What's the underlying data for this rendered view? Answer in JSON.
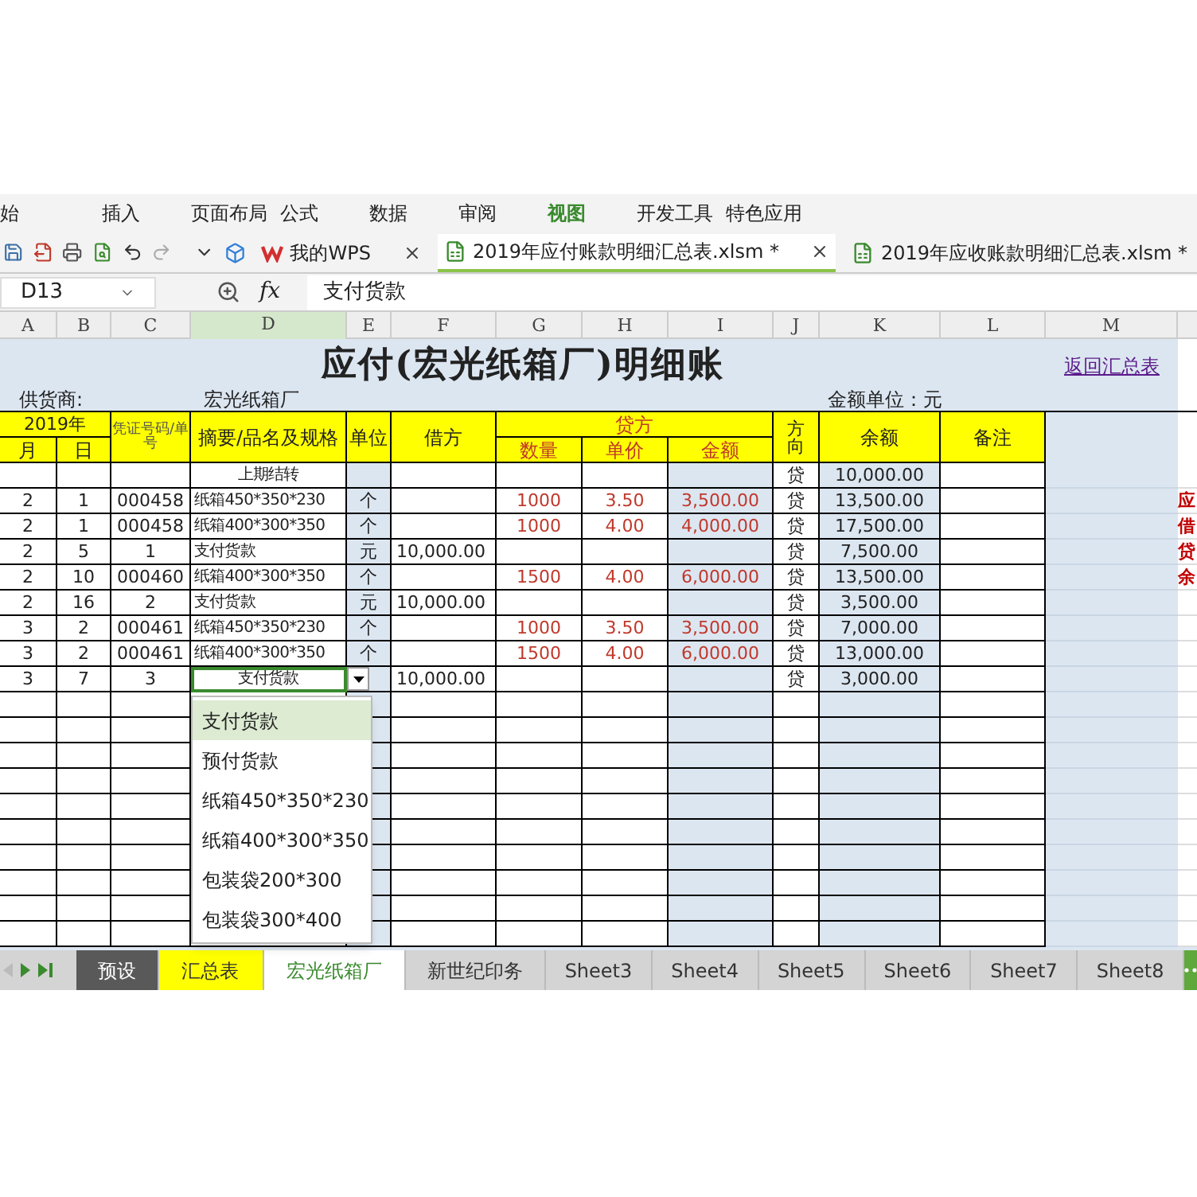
{
  "menu_tabs": [
    {
      "label": "始",
      "selected": false
    },
    {
      "label": "插入",
      "selected": false
    },
    {
      "label": "页面布局",
      "selected": false
    },
    {
      "label": "公式",
      "selected": false
    },
    {
      "label": "数据",
      "selected": false
    },
    {
      "label": "审阅",
      "selected": false
    },
    {
      "label": "视图",
      "selected": true
    },
    {
      "label": "开发工具",
      "selected": false
    },
    {
      "label": "特色应用",
      "selected": false
    }
  ],
  "doc_tabs": [
    {
      "label": "我的WPS",
      "kind": "home",
      "selected": false
    },
    {
      "label": "2019年应付账款明细汇总表.xlsm *",
      "kind": "file",
      "selected": true
    },
    {
      "label": "2019年应收账款明细汇总表.xlsm *",
      "kind": "file",
      "selected": false
    }
  ],
  "formula_bar": {
    "cell_ref": "D13",
    "fx_label": "fx",
    "value": "支付货款"
  },
  "column_headers": [
    {
      "label": "A",
      "selected": false
    },
    {
      "label": "B",
      "selected": false
    },
    {
      "label": "C",
      "selected": false
    },
    {
      "label": "D",
      "selected": true
    },
    {
      "label": "E",
      "selected": false
    },
    {
      "label": "F",
      "selected": false
    },
    {
      "label": "G",
      "selected": false
    },
    {
      "label": "H",
      "selected": false
    },
    {
      "label": "I",
      "selected": false
    },
    {
      "label": "J",
      "selected": false
    },
    {
      "label": "K",
      "selected": false
    },
    {
      "label": "L",
      "selected": false
    },
    {
      "label": "M",
      "selected": false
    }
  ],
  "sheet": {
    "title": "应付(宏光纸箱厂)明细账",
    "back_link": "返回汇总表",
    "supplier_label": "供货商:",
    "supplier": "宏光纸箱厂",
    "unit_note": "金额单位：元",
    "header": {
      "year": "2019年",
      "month": "月",
      "day": "日",
      "voucher": "凭证号码/单号",
      "summary": "摘要/品名及规格",
      "unit": "单位",
      "debit": "借方",
      "credit": "贷方",
      "qty": "数量",
      "price": "单价",
      "amount": "金额",
      "direction_top": "方",
      "direction_bottom": "向",
      "balance": "余额",
      "remark": "备注"
    },
    "rows": [
      {
        "summary": "上期结转",
        "direction": "贷",
        "balance": "10,000.00",
        "selected": false
      },
      {
        "month": "2",
        "day": "1",
        "voucher": "000458",
        "summary": "纸箱450*350*230",
        "unit": "个",
        "qty": "1000",
        "price": "3.50",
        "amount": "3,500.00",
        "direction": "贷",
        "balance": "13,500.00",
        "selected": false
      },
      {
        "month": "2",
        "day": "1",
        "voucher": "000458",
        "summary": "纸箱400*300*350",
        "unit": "个",
        "qty": "1000",
        "price": "4.00",
        "amount": "4,000.00",
        "direction": "贷",
        "balance": "17,500.00",
        "selected": false
      },
      {
        "month": "2",
        "day": "5",
        "voucher": "1",
        "summary": "支付货款",
        "unit": "元",
        "debit": "10,000.00",
        "direction": "贷",
        "balance": "7,500.00",
        "selected": false
      },
      {
        "month": "2",
        "day": "10",
        "voucher": "000460",
        "summary": "纸箱400*300*350",
        "unit": "个",
        "qty": "1500",
        "price": "4.00",
        "amount": "6,000.00",
        "direction": "贷",
        "balance": "13,500.00",
        "selected": false
      },
      {
        "month": "2",
        "day": "16",
        "voucher": "2",
        "summary": "支付货款",
        "unit": "元",
        "debit": "10,000.00",
        "direction": "贷",
        "balance": "3,500.00",
        "selected": false
      },
      {
        "month": "3",
        "day": "2",
        "voucher": "000461",
        "summary": "纸箱450*350*230",
        "unit": "个",
        "qty": "1000",
        "price": "3.50",
        "amount": "3,500.00",
        "direction": "贷",
        "balance": "7,000.00",
        "selected": false
      },
      {
        "month": "3",
        "day": "2",
        "voucher": "000461",
        "summary": "纸箱400*300*350",
        "unit": "个",
        "qty": "1500",
        "price": "4.00",
        "amount": "6,000.00",
        "direction": "贷",
        "balance": "13,000.00",
        "selected": false
      },
      {
        "month": "3",
        "day": "7",
        "voucher": "3",
        "summary": "支付货款",
        "debit": "10,000.00",
        "direction": "贷",
        "balance": "3,000.00",
        "selected": true
      }
    ],
    "side_notes": [
      "应",
      "借",
      "贷",
      "余"
    ]
  },
  "dropdown": {
    "items": [
      {
        "label": "支付货款",
        "selected": true
      },
      {
        "label": "预付货款",
        "selected": false
      },
      {
        "label": "纸箱450*350*230",
        "selected": false
      },
      {
        "label": "纸箱400*300*350",
        "selected": false
      },
      {
        "label": "包装袋200*300",
        "selected": false
      },
      {
        "label": "包装袋300*400",
        "selected": false
      }
    ]
  },
  "sheet_tabs": [
    {
      "label": "预设",
      "selected": false,
      "color": "#595959"
    },
    {
      "label": "汇总表",
      "selected": false,
      "color": "#ffff00"
    },
    {
      "label": "宏光纸箱厂",
      "selected": true
    },
    {
      "label": "新世纪印务",
      "selected": false
    },
    {
      "label": "Sheet3",
      "selected": false
    },
    {
      "label": "Sheet4",
      "selected": false
    },
    {
      "label": "Sheet5",
      "selected": false
    },
    {
      "label": "Sheet6",
      "selected": false
    },
    {
      "label": "Sheet7",
      "selected": false
    },
    {
      "label": "Sheet8",
      "selected": false
    }
  ]
}
